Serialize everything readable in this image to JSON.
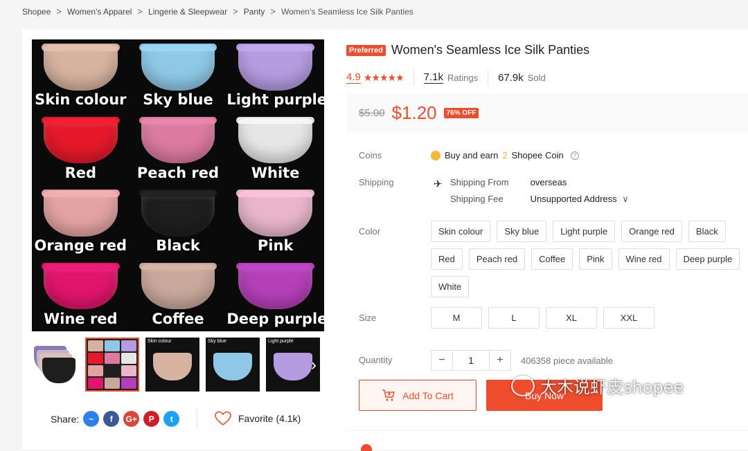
{
  "breadcrumb": [
    "Shopee",
    "Women's Apparel",
    "Lingerie & Sleepwear",
    "Panty",
    "Women's Seamless Ice Silk Panties"
  ],
  "gallery": {
    "swatches": [
      {
        "label": "Skin colour",
        "color": "#d7b2a0"
      },
      {
        "label": "Sky blue",
        "color": "#8ec8e6"
      },
      {
        "label": "Light purple",
        "color": "#b59be0"
      },
      {
        "label": "Red",
        "color": "#e5192a"
      },
      {
        "label": "Peach red",
        "color": "#dc7aa0"
      },
      {
        "label": "White",
        "color": "#e6e6e6"
      },
      {
        "label": "Orange red",
        "color": "#e3a2a2"
      },
      {
        "label": "Black",
        "color": "#1e1e1e"
      },
      {
        "label": "Pink",
        "color": "#e8b5cb"
      },
      {
        "label": "Wine red",
        "color": "#e0156c"
      },
      {
        "label": "Coffee",
        "color": "#c9a89c"
      },
      {
        "label": "Deep purple",
        "color": "#b43fb8"
      }
    ],
    "thumbs": [
      {
        "label": "",
        "color": "#c9b4c8"
      },
      {
        "label": "",
        "color": "#333333"
      },
      {
        "label": "Skin colour",
        "color": "#d7b2a0"
      },
      {
        "label": "Sky blue",
        "color": "#8ec8e6"
      },
      {
        "label": "Light purple",
        "color": "#b59be0"
      }
    ],
    "next_icon": "chevron-right-icon"
  },
  "share": {
    "label": "Share:",
    "networks": [
      {
        "name": "messenger-icon",
        "glyph": "~",
        "color": "#2f80ed"
      },
      {
        "name": "facebook-icon",
        "glyph": "f",
        "color": "#3b5998"
      },
      {
        "name": "google-plus-icon",
        "glyph": "G+",
        "color": "#db4437"
      },
      {
        "name": "pinterest-icon",
        "glyph": "P",
        "color": "#cb2027"
      },
      {
        "name": "twitter-icon",
        "glyph": "t",
        "color": "#1da1f2"
      }
    ]
  },
  "favorite": {
    "label": "Favorite (4.1k)"
  },
  "product": {
    "badge": "Preferred",
    "title": "Women's Seamless Ice Silk Panties",
    "rating": "4.9",
    "stars": "★★★★★",
    "ratings_count": "7.1k",
    "ratings_label": "Ratings",
    "sold_count": "67.9k",
    "sold_label": "Sold",
    "old_price": "$5.00",
    "price": "$1.20",
    "discount": "76% OFF"
  },
  "coins": {
    "label": "Coins",
    "text_before": "Buy and earn",
    "amount": "2",
    "text_after": "Shopee Coin",
    "help": "?"
  },
  "shipping": {
    "label": "Shipping",
    "from_label": "Shipping From",
    "from_value": "overseas",
    "fee_label": "Shipping Fee",
    "fee_value": "Unsupported Address",
    "chevron": "∨"
  },
  "color": {
    "label": "Color",
    "options": [
      "Skin colour",
      "Sky blue",
      "Light purple",
      "Orange red",
      "Black",
      "Red",
      "Peach red",
      "Coffee",
      "Pink",
      "Wine red",
      "Deep purple",
      "White"
    ]
  },
  "size": {
    "label": "Size",
    "options": [
      "M",
      "L",
      "XL",
      "XXL"
    ]
  },
  "quantity": {
    "label": "Quantity",
    "minus": "−",
    "value": "1",
    "plus": "+",
    "available": "406358 piece available"
  },
  "actions": {
    "add_to_cart": "Add To Cart",
    "buy_now": "Buy Now"
  },
  "watermark": {
    "text": "大木说虾皮shopee"
  },
  "colors": {
    "accent": "#ee4d2d",
    "coin": "#f6b935"
  }
}
